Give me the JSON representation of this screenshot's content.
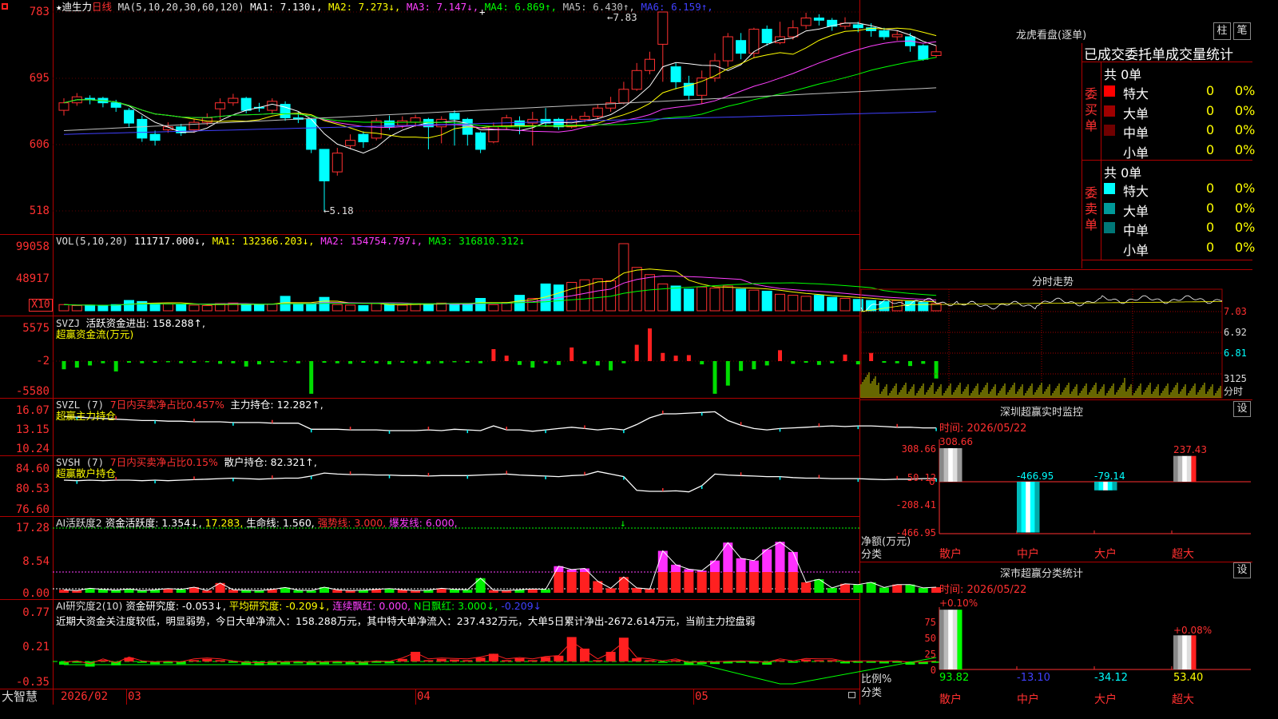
{
  "header": {
    "star": "★",
    "stock_name": "迪生力",
    "period": "日线",
    "ma_params": "MA(5,10,20,30,60,120)",
    "ma": [
      {
        "label": "MA1: 7.130↓",
        "color": "#ffffff"
      },
      {
        "label": "MA2: 7.273↓",
        "color": "#ffff00"
      },
      {
        "label": "MA3: 7.147↓",
        "color": "#ff40ff"
      },
      {
        "label": "MA4: 6.869↑",
        "color": "#00ff00"
      },
      {
        "label": "MA5: 6.430↑",
        "color": "#c0c0c0"
      },
      {
        "label": "MA6: 6.159↑",
        "color": "#4040ff"
      }
    ],
    "high_mark": "7.83",
    "low_mark": "5.18",
    "cross": "+"
  },
  "price_axis": [
    "783",
    "695",
    "606",
    "518"
  ],
  "vol": {
    "params": "VOL(5,10,20)",
    "value": "111717.000↓",
    "ma1": "MA1: 132366.203↓",
    "ma2": "MA2: 154754.797↓",
    "ma3": "MA3: 316810.312↓",
    "axis": [
      "99058",
      "48917"
    ],
    "unit": "X10"
  },
  "svzj": {
    "name": "SVZJ",
    "desc": "活跃资金进出: 158.288↑,",
    "sub": "超赢资金流(万元)",
    "axis": [
      "5575",
      "-2",
      "-5580"
    ]
  },
  "svzl": {
    "name": "SVZL (7)",
    "desc": "7日内买卖净占比0.457%",
    "extra": "主力持仓: 12.282↑,",
    "sub": "超赢主力持仓",
    "axis": [
      "16.07",
      "13.15",
      "10.24"
    ]
  },
  "svsh": {
    "name": "SVSH (7)",
    "desc": "7日内买卖净占比0.15%",
    "extra": "散户持仓: 82.321↑,",
    "sub": "超赢散户持仓",
    "axis": [
      "84.60",
      "80.53",
      "76.60"
    ]
  },
  "ai2": {
    "name": "AI活跃度2",
    "l1": "资金活跃度: 1.354↓",
    "l2": "17.283",
    "l3": "生命线: 1.560",
    "l4": "强势线: 3.000",
    "l5": "爆发线: 6.000",
    "arrow": "↓",
    "axis": [
      "17.28",
      "8.54",
      "0.00"
    ]
  },
  "ai3": {
    "name": "AI研究度2(10)",
    "l1": "资金研究度: -0.053↓",
    "l2": "平均研究度: -0.209↓",
    "l3": "连续飘红: 0.000",
    "l4": "N日飘红: 3.000↓",
    "l5": "-0.209↓",
    "comment": "近期大资金关注度较低，明显弱势，今日大单净流入：158.288万元，其中特大单净流入：237.432万元，大单5日累计净出-2672.614万元，当前主力控盘弱",
    "axis": [
      "0.77",
      "0.21",
      "-0.35"
    ]
  },
  "bottom": {
    "brand": "大智慧",
    "dates": [
      "2026/02",
      "03",
      "04",
      "05"
    ]
  },
  "lhb": {
    "title": "龙虎看盘(逐单)",
    "btn1": "柱",
    "btn2": "笔",
    "subtitle": "已成交委托单成交量统计",
    "buy_side": "委买单",
    "sell_side": "委卖单",
    "buy_total": "共 0单",
    "sell_total": "共 0单",
    "buy_rows": [
      {
        "name": "特大",
        "val": "0",
        "pct": "0%",
        "color": "#ff0000"
      },
      {
        "name": "大单",
        "val": "0",
        "pct": "0%",
        "color": "#a00000"
      },
      {
        "name": "中单",
        "val": "0",
        "pct": "0%",
        "color": "#700000"
      },
      {
        "name": "小单",
        "val": "0",
        "pct": "0%",
        "color": "#000000"
      }
    ],
    "sell_rows": [
      {
        "name": "特大",
        "val": "0",
        "pct": "0%",
        "color": "#00ffff"
      },
      {
        "name": "大单",
        "val": "0",
        "pct": "0%",
        "color": "#009999"
      },
      {
        "name": "中单",
        "val": "0",
        "pct": "0%",
        "color": "#007777"
      },
      {
        "name": "小单",
        "val": "0",
        "pct": "0%",
        "color": "#000000"
      }
    ]
  },
  "fs": {
    "title": "分时走势",
    "axis": [
      "7.03",
      "6.92",
      "6.81"
    ],
    "vol_label": "3125",
    "vol_unit": "分时"
  },
  "szjk": {
    "title": "深圳超赢实时监控",
    "btn": "设",
    "time": "时间: 2026/05/22",
    "axis": [
      "308.66",
      "50.12",
      "-208.41",
      "-466.95"
    ],
    "zero": "0",
    "ylabel": "净额(万元)",
    "xlabel": "分类",
    "cats": [
      "散户",
      "中户",
      "大户",
      "超大"
    ],
    "vals": [
      "308.66",
      "-466.95",
      "-79.14",
      "237.43"
    ]
  },
  "sstj": {
    "title": "深市超赢分类统计",
    "btn": "设",
    "time": "时间: 2026/05/22",
    "axis": [
      "75",
      "50",
      "25",
      "0"
    ],
    "ylabel": "比例%",
    "xlabel": "分类",
    "cats": [
      "散户",
      "中户",
      "大户",
      "超大"
    ],
    "top": [
      "+0.10%",
      "",
      "",
      "+0.08%"
    ],
    "bottom": [
      "93.82",
      "-13.10",
      "-34.12",
      "53.40"
    ]
  },
  "chart_data": [
    {
      "type": "candlestick",
      "title": "迪生力 日线",
      "ylim": [
        5.18,
        7.83
      ],
      "x": [
        "2026/02",
        "03",
        "04",
        "05"
      ],
      "candles": [
        [
          6.52,
          6.62,
          6.68,
          6.45
        ],
        [
          6.62,
          6.7,
          6.75,
          6.58
        ],
        [
          6.68,
          6.66,
          6.72,
          6.6
        ],
        [
          6.68,
          6.62,
          6.7,
          6.56
        ],
        [
          6.62,
          6.56,
          6.66,
          6.5
        ],
        [
          6.52,
          6.35,
          6.55,
          6.3
        ],
        [
          6.4,
          6.15,
          6.45,
          6.1
        ],
        [
          6.2,
          6.12,
          6.25,
          6.05
        ],
        [
          6.26,
          6.3,
          6.36,
          6.22
        ],
        [
          6.3,
          6.22,
          6.34,
          6.18
        ],
        [
          6.26,
          6.36,
          6.4,
          6.22
        ],
        [
          6.36,
          6.42,
          6.48,
          6.32
        ],
        [
          6.54,
          6.62,
          6.68,
          6.4
        ],
        [
          6.62,
          6.68,
          6.74,
          6.58
        ],
        [
          6.68,
          6.52,
          6.7,
          6.48
        ],
        [
          6.56,
          6.55,
          6.62,
          6.5
        ],
        [
          6.52,
          6.64,
          6.68,
          6.48
        ],
        [
          6.6,
          6.42,
          6.64,
          6.38
        ],
        [
          6.42,
          6.4,
          6.5,
          6.35
        ],
        [
          6.4,
          6.0,
          6.42,
          5.95
        ],
        [
          6.0,
          5.58,
          6.0,
          5.18
        ],
        [
          5.7,
          5.95,
          6.02,
          5.65
        ],
        [
          6.05,
          6.12,
          6.2,
          6.0
        ],
        [
          6.2,
          6.1,
          6.24,
          6.02
        ],
        [
          6.15,
          6.38,
          6.42,
          6.12
        ],
        [
          6.38,
          6.3,
          6.45,
          6.26
        ],
        [
          6.32,
          6.38,
          6.44,
          6.28
        ],
        [
          6.36,
          6.42,
          6.46,
          6.3
        ],
        [
          6.4,
          6.3,
          6.42,
          6.0
        ],
        [
          6.3,
          6.4,
          6.44,
          6.08
        ],
        [
          6.48,
          6.4,
          6.52,
          6.05
        ],
        [
          6.4,
          6.2,
          6.42,
          6.05
        ],
        [
          6.22,
          6.0,
          6.24,
          5.95
        ],
        [
          6.1,
          6.3,
          6.36,
          6.08
        ],
        [
          6.3,
          6.42,
          6.46,
          6.26
        ],
        [
          6.38,
          6.32,
          6.44,
          6.2
        ],
        [
          6.35,
          6.4,
          6.5,
          6.05
        ],
        [
          6.4,
          6.35,
          6.55,
          6.3
        ],
        [
          6.4,
          6.3,
          6.42,
          6.26
        ],
        [
          6.3,
          6.4,
          6.45,
          6.28
        ],
        [
          6.4,
          6.44,
          6.5,
          6.36
        ],
        [
          6.44,
          6.55,
          6.6,
          6.4
        ],
        [
          6.55,
          6.62,
          6.7,
          6.5
        ],
        [
          6.62,
          6.8,
          6.9,
          6.6
        ],
        [
          6.8,
          7.05,
          7.15,
          6.78
        ],
        [
          7.05,
          7.2,
          7.3,
          7.0
        ],
        [
          7.4,
          7.83,
          7.83,
          6.9
        ],
        [
          7.1,
          6.9,
          7.15,
          6.8
        ],
        [
          6.88,
          6.72,
          6.98,
          6.65
        ],
        [
          6.72,
          6.95,
          7.05,
          6.6
        ],
        [
          6.95,
          7.18,
          7.28,
          6.9
        ],
        [
          7.18,
          7.5,
          7.55,
          7.1
        ],
        [
          7.45,
          7.28,
          7.55,
          7.2
        ],
        [
          7.28,
          7.6,
          7.62,
          7.22
        ],
        [
          7.6,
          7.42,
          7.65,
          7.38
        ],
        [
          7.42,
          7.5,
          7.7,
          7.4
        ],
        [
          7.5,
          7.62,
          7.72,
          7.46
        ],
        [
          7.65,
          7.75,
          7.82,
          7.6
        ],
        [
          7.75,
          7.72,
          7.8,
          7.65
        ],
        [
          7.72,
          7.64,
          7.75,
          7.58
        ],
        [
          7.64,
          7.68,
          7.76,
          7.6
        ],
        [
          7.66,
          7.62,
          7.7,
          7.56
        ],
        [
          7.62,
          7.58,
          7.68,
          7.5
        ],
        [
          7.58,
          7.5,
          7.62,
          7.46
        ],
        [
          7.5,
          7.53,
          7.58,
          7.45
        ],
        [
          7.5,
          7.38,
          7.55,
          7.3
        ],
        [
          7.38,
          7.2,
          7.4,
          7.18
        ],
        [
          7.25,
          7.3,
          7.38,
          7.22
        ]
      ]
    },
    {
      "type": "bar",
      "title": "VOL(5,10,20)",
      "values": [
        12,
        10,
        11,
        10,
        12,
        20,
        18,
        14,
        13,
        12,
        11,
        10,
        14,
        15,
        12,
        11,
        13,
        28,
        14,
        13,
        26,
        12,
        11,
        10,
        14,
        12,
        11,
        14,
        13,
        15,
        14,
        13,
        24,
        12,
        16,
        30,
        24,
        52,
        50,
        55,
        60,
        62,
        58,
        130,
        84,
        70,
        52,
        48,
        42,
        46,
        44,
        48,
        42,
        40,
        38,
        32,
        30,
        28,
        30,
        26,
        24,
        22,
        20,
        18,
        20,
        18,
        16,
        14
      ],
      "ylim": [
        0,
        99058
      ]
    },
    {
      "type": "bar",
      "title": "超赢资金流(万元)",
      "values": [
        -1500,
        -1200,
        -800,
        -400,
        -1900,
        -300,
        -400,
        -300,
        -200,
        -400,
        -300,
        -200,
        -500,
        -400,
        -1000,
        -600,
        -300,
        -200,
        -400,
        -6000,
        -300,
        -400,
        -500,
        -300,
        -400,
        -600,
        -300,
        -400,
        -500,
        -400,
        -200,
        -300,
        -400,
        2200,
        1000,
        -700,
        -1200,
        -400,
        -700,
        2500,
        -500,
        -800,
        -1700,
        -400,
        3000,
        6000,
        1500,
        1000,
        1100,
        -600,
        -6000,
        -4500,
        -1800,
        -1500,
        -800,
        2000,
        -500,
        -300,
        -700,
        -400,
        1200,
        -600,
        1500,
        -300,
        -400,
        -900,
        -500,
        -3200
      ],
      "ylim": [
        -5580,
        5575
      ]
    },
    {
      "type": "line",
      "title": "超赢主力持仓",
      "values": [
        15.2,
        15.1,
        15.0,
        14.9,
        14.8,
        14.7,
        14.6,
        14.6,
        14.5,
        14.5,
        14.4,
        14.4,
        14.4,
        14.3,
        14.3,
        14.3,
        14.2,
        14.2,
        14.2,
        13.3,
        13.3,
        13.3,
        13.2,
        13.2,
        13.2,
        13.1,
        13.1,
        13.1,
        13.2,
        13.1,
        13.3,
        13.2,
        13.1,
        13.8,
        13.2,
        13.2,
        13.0,
        13.2,
        13.4,
        13.6,
        13.4,
        13.2,
        13.4,
        13.2,
        14.0,
        15.0,
        15.6,
        15.6,
        15.7,
        15.8,
        15.9,
        14.6,
        13.9,
        13.4,
        13.2,
        13.4,
        13.5,
        13.6,
        13.7,
        13.8,
        13.7,
        13.8,
        13.8,
        13.7,
        13.6,
        13.6,
        13.5,
        13.5
      ],
      "ylim": [
        10.24,
        16.07
      ]
    },
    {
      "type": "line",
      "title": "超赢散户持仓",
      "values": [
        82.4,
        82.3,
        82.4,
        82.3,
        82.4,
        82.4,
        82.3,
        82.4,
        82.3,
        82.4,
        82.5,
        82.6,
        82.7,
        82.8,
        82.7,
        82.6,
        82.7,
        82.8,
        82.8,
        83.2,
        83.8,
        83.6,
        83.5,
        83.5,
        83.4,
        83.4,
        83.3,
        83.3,
        83.2,
        83.3,
        83.3,
        83.3,
        83.4,
        83.5,
        83.6,
        83.4,
        83.3,
        83.2,
        83.1,
        83.3,
        83.4,
        84.1,
        83.6,
        83.1,
        80.4,
        80.2,
        80.2,
        80.3,
        80.1,
        81.3,
        83.6,
        83.4,
        83.3,
        83.2,
        83.1,
        83.1,
        82.9,
        82.8,
        82.8,
        82.7,
        82.7,
        82.7,
        82.6,
        82.5,
        82.6,
        82.6,
        82.7,
        82.7
      ],
      "ylim": [
        76.6,
        84.6
      ]
    },
    {
      "type": "bar",
      "title": "AI活跃度2",
      "values": [
        0.8,
        0.6,
        1.2,
        0.9,
        0.7,
        1.0,
        0.6,
        0.8,
        1.1,
        0.9,
        1.5,
        0.6,
        2.6,
        0.8,
        0.7,
        0.6,
        0.9,
        1.4,
        0.7,
        0.6,
        1.5,
        0.8,
        0.6,
        0.7,
        0.9,
        1.1,
        0.8,
        0.6,
        0.7,
        1.2,
        0.9,
        0.8,
        3.9,
        0.7,
        0.6,
        0.8,
        1.0,
        0.9,
        7.1,
        6.2,
        6.5,
        3.1,
        1.2,
        4.2,
        1.3,
        1.0,
        11.2,
        7.5,
        6.3,
        5.9,
        8.6,
        13.4,
        9.2,
        8.6,
        11.6,
        13.6,
        10.9,
        2.8,
        3.6,
        1.3,
        2.4,
        2.2,
        2.8,
        1.4,
        2.2,
        2.2,
        1.3,
        1.5
      ],
      "ylim": [
        0,
        17.28
      ]
    },
    {
      "type": "bar",
      "title": "AI研究度2(10)",
      "values": [
        -0.05,
        -0.02,
        -0.08,
        0.02,
        -0.06,
        0.06,
        -0.02,
        -0.04,
        -0.03,
        -0.04,
        0.02,
        0.04,
        0.02,
        -0.02,
        -0.05,
        -0.06,
        -0.05,
        -0.04,
        -0.03,
        -0.05,
        -0.04,
        -0.03,
        -0.04,
        -0.05,
        -0.02,
        -0.03,
        0.04,
        0.15,
        0.02,
        0.04,
        0.03,
        0.02,
        0.06,
        0.12,
        0.02,
        0.05,
        0.02,
        0.07,
        0.09,
        0.38,
        0.2,
        0.02,
        0.15,
        0.37,
        0.05,
        0.02,
        -0.02,
        0.02,
        -0.05,
        -0.04,
        -0.04,
        -0.03,
        -0.02,
        -0.03,
        -0.05,
        0.02,
        -0.02,
        0.03,
        0.02,
        0.02,
        -0.03,
        -0.02,
        -0.02,
        -0.03,
        -0.02,
        -0.05,
        -0.04,
        -0.02
      ],
      "ylim": [
        -0.35,
        0.77
      ]
    },
    {
      "type": "bar",
      "title": "深圳超赢实时监控",
      "categories": [
        "散户",
        "中户",
        "大户",
        "超大"
      ],
      "values": [
        308.66,
        -466.95,
        -79.14,
        237.43
      ],
      "ylim": [
        -466.95,
        308.66
      ]
    },
    {
      "type": "bar",
      "title": "深市超赢分类统计",
      "categories": [
        "散户",
        "中户",
        "大户",
        "超大"
      ],
      "values": [
        93.82,
        -13.1,
        -34.12,
        53.4
      ],
      "ylim": [
        0,
        75
      ]
    }
  ]
}
